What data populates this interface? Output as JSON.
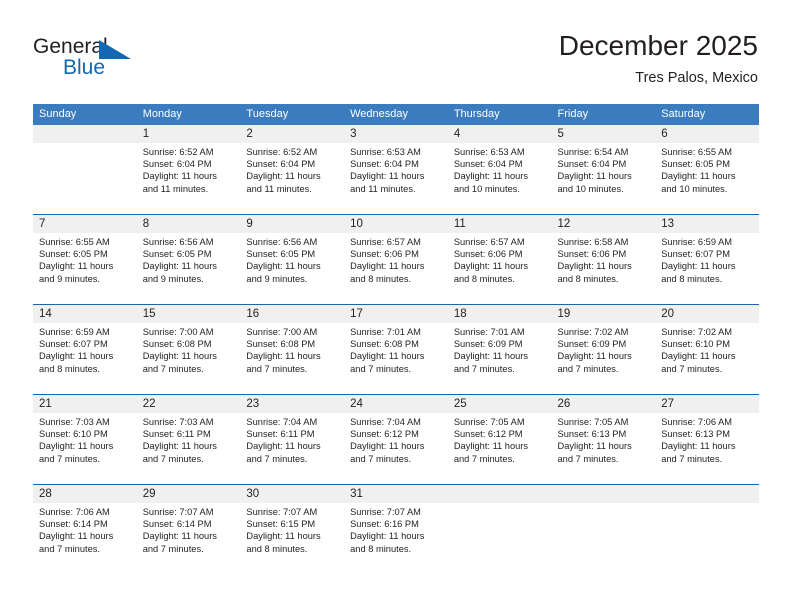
{
  "brand": {
    "word1": "General",
    "word2": "Blue",
    "flag_icon": "triangle-flag-icon",
    "color_text": "#231f20",
    "color_blue": "#1268b3"
  },
  "header": {
    "title": "December 2025",
    "subtitle": "Tres Palos, Mexico"
  },
  "theme": {
    "header_bg": "#3a7cbe",
    "header_text": "#ffffff",
    "row_divider": "#1f63a8",
    "daynum_band_bg": "#f0f0f0",
    "cell_bg": "#ffffff",
    "text": "#231f20"
  },
  "calendar": {
    "day_headers": [
      "Sunday",
      "Monday",
      "Tuesday",
      "Wednesday",
      "Thursday",
      "Friday",
      "Saturday"
    ],
    "weeks": [
      [
        {
          "day": "",
          "lines": []
        },
        {
          "day": "1",
          "lines": [
            "Sunrise: 6:52 AM",
            "Sunset: 6:04 PM",
            "Daylight: 11 hours",
            "and 11 minutes."
          ]
        },
        {
          "day": "2",
          "lines": [
            "Sunrise: 6:52 AM",
            "Sunset: 6:04 PM",
            "Daylight: 11 hours",
            "and 11 minutes."
          ]
        },
        {
          "day": "3",
          "lines": [
            "Sunrise: 6:53 AM",
            "Sunset: 6:04 PM",
            "Daylight: 11 hours",
            "and 11 minutes."
          ]
        },
        {
          "day": "4",
          "lines": [
            "Sunrise: 6:53 AM",
            "Sunset: 6:04 PM",
            "Daylight: 11 hours",
            "and 10 minutes."
          ]
        },
        {
          "day": "5",
          "lines": [
            "Sunrise: 6:54 AM",
            "Sunset: 6:04 PM",
            "Daylight: 11 hours",
            "and 10 minutes."
          ]
        },
        {
          "day": "6",
          "lines": [
            "Sunrise: 6:55 AM",
            "Sunset: 6:05 PM",
            "Daylight: 11 hours",
            "and 10 minutes."
          ]
        }
      ],
      [
        {
          "day": "7",
          "lines": [
            "Sunrise: 6:55 AM",
            "Sunset: 6:05 PM",
            "Daylight: 11 hours",
            "and 9 minutes."
          ]
        },
        {
          "day": "8",
          "lines": [
            "Sunrise: 6:56 AM",
            "Sunset: 6:05 PM",
            "Daylight: 11 hours",
            "and 9 minutes."
          ]
        },
        {
          "day": "9",
          "lines": [
            "Sunrise: 6:56 AM",
            "Sunset: 6:05 PM",
            "Daylight: 11 hours",
            "and 9 minutes."
          ]
        },
        {
          "day": "10",
          "lines": [
            "Sunrise: 6:57 AM",
            "Sunset: 6:06 PM",
            "Daylight: 11 hours",
            "and 8 minutes."
          ]
        },
        {
          "day": "11",
          "lines": [
            "Sunrise: 6:57 AM",
            "Sunset: 6:06 PM",
            "Daylight: 11 hours",
            "and 8 minutes."
          ]
        },
        {
          "day": "12",
          "lines": [
            "Sunrise: 6:58 AM",
            "Sunset: 6:06 PM",
            "Daylight: 11 hours",
            "and 8 minutes."
          ]
        },
        {
          "day": "13",
          "lines": [
            "Sunrise: 6:59 AM",
            "Sunset: 6:07 PM",
            "Daylight: 11 hours",
            "and 8 minutes."
          ]
        }
      ],
      [
        {
          "day": "14",
          "lines": [
            "Sunrise: 6:59 AM",
            "Sunset: 6:07 PM",
            "Daylight: 11 hours",
            "and 8 minutes."
          ]
        },
        {
          "day": "15",
          "lines": [
            "Sunrise: 7:00 AM",
            "Sunset: 6:08 PM",
            "Daylight: 11 hours",
            "and 7 minutes."
          ]
        },
        {
          "day": "16",
          "lines": [
            "Sunrise: 7:00 AM",
            "Sunset: 6:08 PM",
            "Daylight: 11 hours",
            "and 7 minutes."
          ]
        },
        {
          "day": "17",
          "lines": [
            "Sunrise: 7:01 AM",
            "Sunset: 6:08 PM",
            "Daylight: 11 hours",
            "and 7 minutes."
          ]
        },
        {
          "day": "18",
          "lines": [
            "Sunrise: 7:01 AM",
            "Sunset: 6:09 PM",
            "Daylight: 11 hours",
            "and 7 minutes."
          ]
        },
        {
          "day": "19",
          "lines": [
            "Sunrise: 7:02 AM",
            "Sunset: 6:09 PM",
            "Daylight: 11 hours",
            "and 7 minutes."
          ]
        },
        {
          "day": "20",
          "lines": [
            "Sunrise: 7:02 AM",
            "Sunset: 6:10 PM",
            "Daylight: 11 hours",
            "and 7 minutes."
          ]
        }
      ],
      [
        {
          "day": "21",
          "lines": [
            "Sunrise: 7:03 AM",
            "Sunset: 6:10 PM",
            "Daylight: 11 hours",
            "and 7 minutes."
          ]
        },
        {
          "day": "22",
          "lines": [
            "Sunrise: 7:03 AM",
            "Sunset: 6:11 PM",
            "Daylight: 11 hours",
            "and 7 minutes."
          ]
        },
        {
          "day": "23",
          "lines": [
            "Sunrise: 7:04 AM",
            "Sunset: 6:11 PM",
            "Daylight: 11 hours",
            "and 7 minutes."
          ]
        },
        {
          "day": "24",
          "lines": [
            "Sunrise: 7:04 AM",
            "Sunset: 6:12 PM",
            "Daylight: 11 hours",
            "and 7 minutes."
          ]
        },
        {
          "day": "25",
          "lines": [
            "Sunrise: 7:05 AM",
            "Sunset: 6:12 PM",
            "Daylight: 11 hours",
            "and 7 minutes."
          ]
        },
        {
          "day": "26",
          "lines": [
            "Sunrise: 7:05 AM",
            "Sunset: 6:13 PM",
            "Daylight: 11 hours",
            "and 7 minutes."
          ]
        },
        {
          "day": "27",
          "lines": [
            "Sunrise: 7:06 AM",
            "Sunset: 6:13 PM",
            "Daylight: 11 hours",
            "and 7 minutes."
          ]
        }
      ],
      [
        {
          "day": "28",
          "lines": [
            "Sunrise: 7:06 AM",
            "Sunset: 6:14 PM",
            "Daylight: 11 hours",
            "and 7 minutes."
          ]
        },
        {
          "day": "29",
          "lines": [
            "Sunrise: 7:07 AM",
            "Sunset: 6:14 PM",
            "Daylight: 11 hours",
            "and 7 minutes."
          ]
        },
        {
          "day": "30",
          "lines": [
            "Sunrise: 7:07 AM",
            "Sunset: 6:15 PM",
            "Daylight: 11 hours",
            "and 8 minutes."
          ]
        },
        {
          "day": "31",
          "lines": [
            "Sunrise: 7:07 AM",
            "Sunset: 6:16 PM",
            "Daylight: 11 hours",
            "and 8 minutes."
          ]
        },
        {
          "day": "",
          "lines": []
        },
        {
          "day": "",
          "lines": []
        },
        {
          "day": "",
          "lines": []
        }
      ]
    ]
  }
}
